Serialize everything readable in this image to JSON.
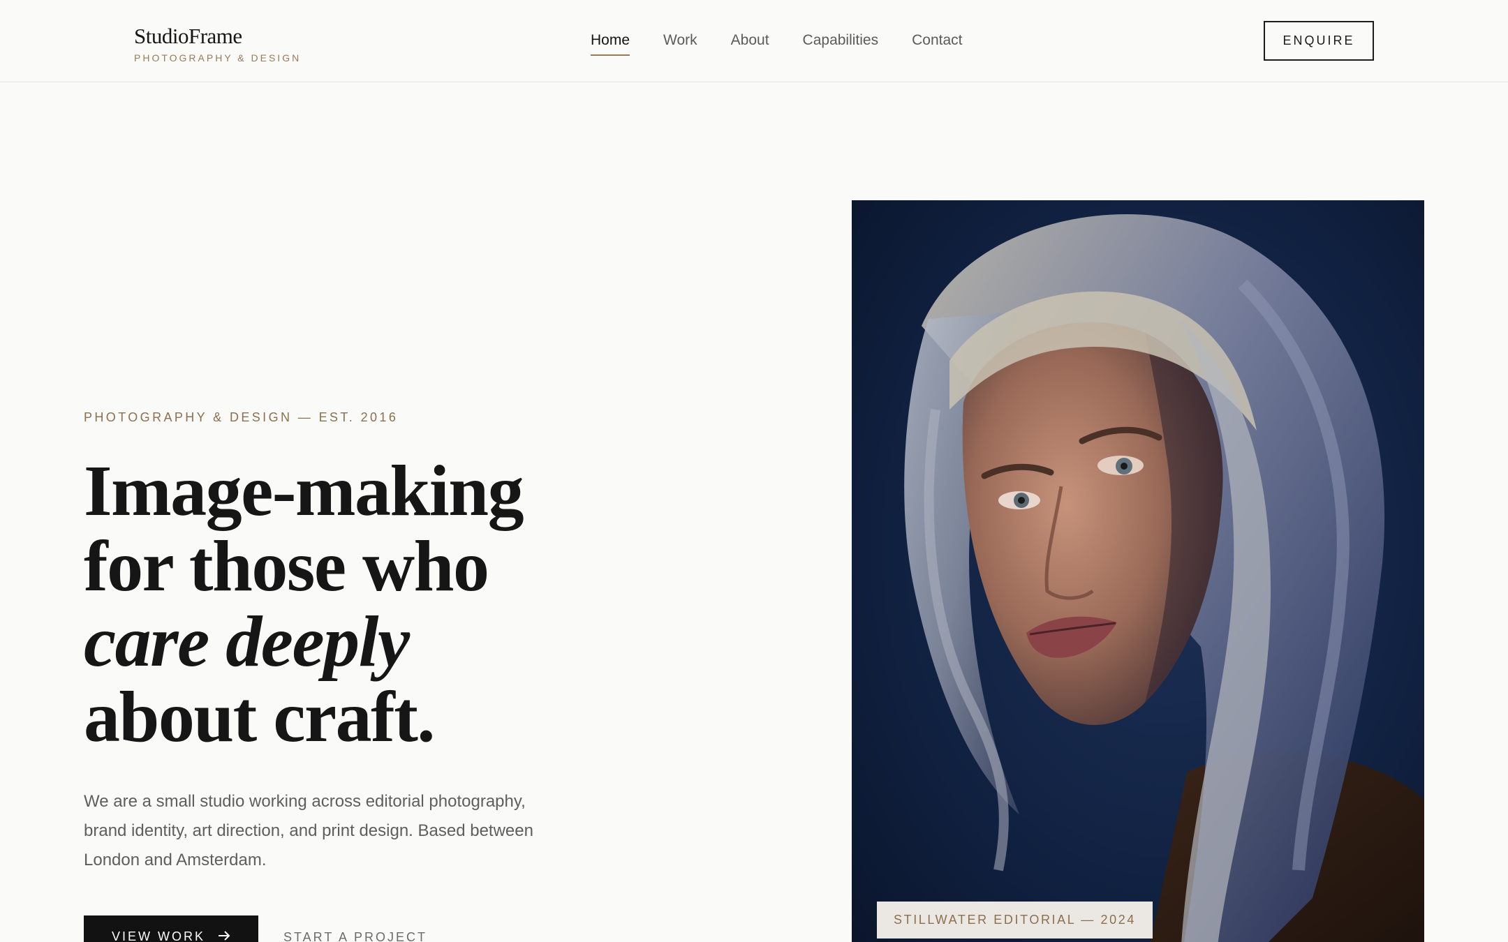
{
  "brand": {
    "name": "StudioFrame",
    "tagline": "PHOTOGRAPHY & DESIGN"
  },
  "nav": {
    "items": [
      {
        "label": "Home",
        "active": true
      },
      {
        "label": "Work",
        "active": false
      },
      {
        "label": "About",
        "active": false
      },
      {
        "label": "Capabilities",
        "active": false
      },
      {
        "label": "Contact",
        "active": false
      }
    ],
    "cta_label": "ENQUIRE"
  },
  "hero": {
    "eyebrow": "PHOTOGRAPHY & DESIGN — EST. 2016",
    "headline": {
      "line1": "Image-making",
      "line2": "for those who",
      "line3_italic": "care deeply",
      "line4": "about craft."
    },
    "intro": "We are a small studio working across editorial photography, brand identity, art direction, and print design. Based between London and Amsterdam.",
    "primary_button": "VIEW WORK",
    "primary_button_icon": "arrow-right-icon",
    "secondary_button": "START A PROJECT",
    "image_caption": "STILLWATER EDITORIAL — 2024"
  },
  "colors": {
    "accent": "#9a7a55",
    "background": "#fafaf9",
    "ink": "#161616",
    "button_dark": "#121212"
  }
}
